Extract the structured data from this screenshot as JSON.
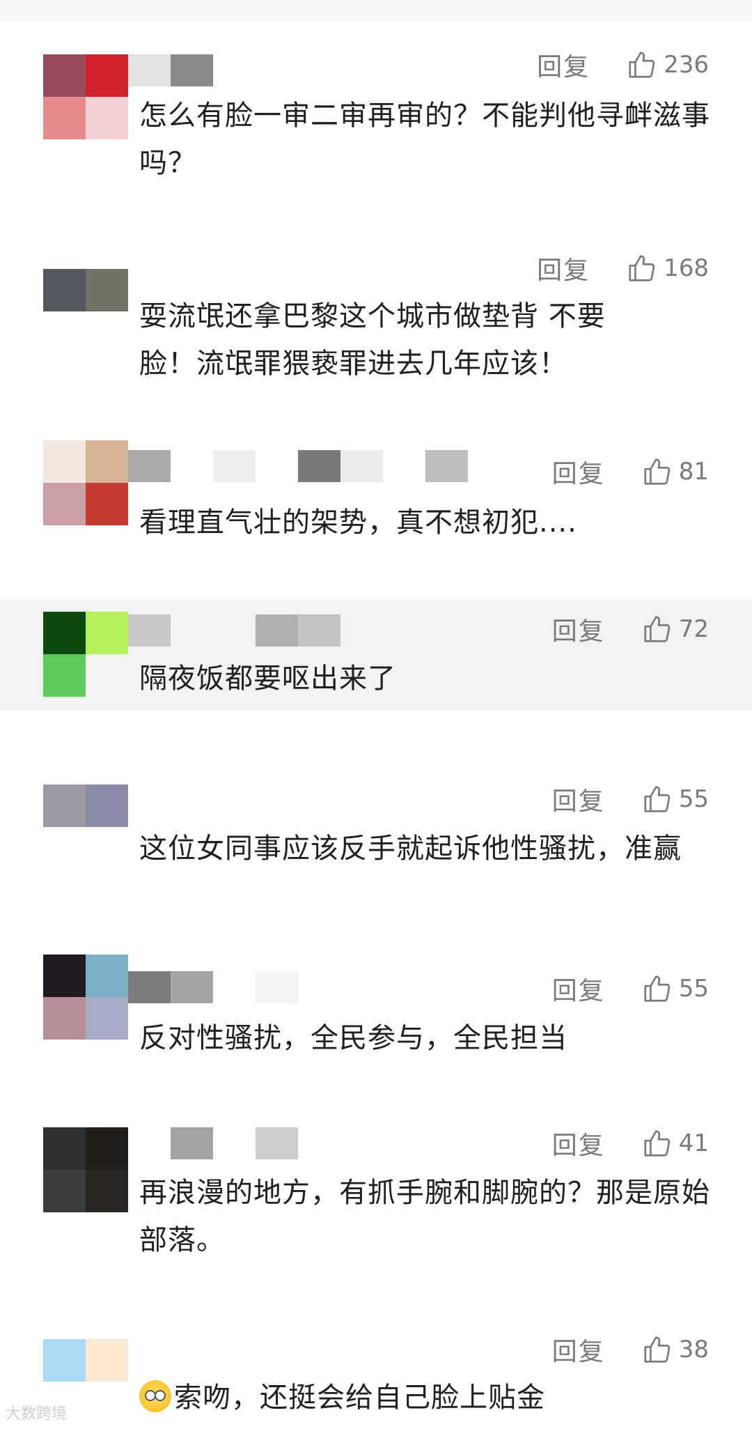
{
  "reply_label": "回复",
  "comments": [
    {
      "likes": "236",
      "text": "怎么有脸一审二审再审的？不能判他寻衅滋事吗？",
      "avatar_colors": [
        "#9a4b5c",
        "#d4222d",
        "#e78a8e",
        "#f5d3d5"
      ],
      "name_colors": [
        "#e2e2e2",
        "#8a8a8a"
      ]
    },
    {
      "likes": "168",
      "text": "耍流氓还拿巴黎这个城市做垫背 不要脸！流氓罪猥亵罪进去几年应该！",
      "avatar_colors": [
        "#55575f",
        "#737365",
        "#ffffff",
        "#ffffff"
      ],
      "name_colors": []
    },
    {
      "likes": "81",
      "text": "看理直气壮的架势，真不想初犯....",
      "avatar_colors": [
        "#f3e8de",
        "#d9b494",
        "#cb9ea6",
        "#c43a2f"
      ],
      "name_colors": [
        "#a9a9a9",
        "#ffffff",
        "#ededed",
        "#ffffff",
        "#7a7a7a",
        "#ececec",
        "#ffffff",
        "#bdbdbd"
      ]
    },
    {
      "likes": "72",
      "text": "隔夜饭都要呕出来了",
      "avatar_colors": [
        "#0d4a0d",
        "#b5f05a",
        "#5fc95a",
        "#f2f2f2"
      ],
      "name_colors": [
        "#c8c8c8",
        "#f2f2f2",
        "#f2f2f2",
        "#b0b0b0",
        "#c4c4c4"
      ],
      "highlight": true
    },
    {
      "likes": "55",
      "text": "这位女同事应该反手就起诉他性骚扰，准赢",
      "avatar_colors": [
        "#9b97a3",
        "#898aa5",
        "#ffffff",
        "#ffffff"
      ],
      "name_colors": []
    },
    {
      "likes": "55",
      "text": "反对性骚扰，全民参与，全民担当",
      "avatar_colors": [
        "#221b22",
        "#7ab0c8",
        "#b48e95",
        "#a6acc7"
      ],
      "name_colors": [
        "#7b7b7b",
        "#a5a5a5",
        "#ffffff",
        "#f3f3f3"
      ]
    },
    {
      "likes": "41",
      "text": "再浪漫的地方，有抓手腕和脚腕的？那是原始部落。",
      "avatar_colors": [
        "#2f3230",
        "#231f1b",
        "#3a3d3b",
        "#2a2723"
      ],
      "name_colors": [
        "#ffffff",
        "#a3a3a3",
        "#ffffff",
        "#cccccc"
      ]
    },
    {
      "likes": "38",
      "text": "索吻，还挺会给自己脸上贴金",
      "has_emoji": true,
      "avatar_colors": [
        "#a9d9f5",
        "#fbe9d3",
        "#ffffff",
        "#ffffff"
      ],
      "name_colors": []
    }
  ],
  "watermark": "大数跨境"
}
